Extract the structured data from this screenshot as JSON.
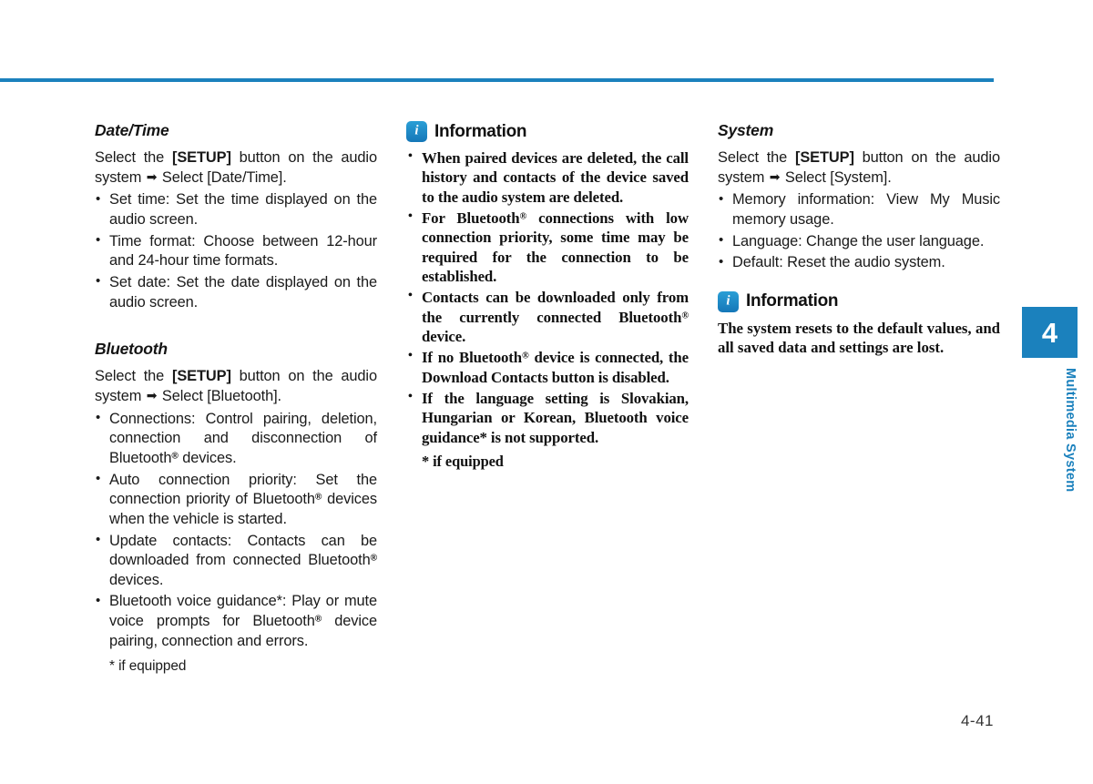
{
  "page": {
    "number": "4-41",
    "chapter_number": "4",
    "chapter_label": "Multimedia System",
    "accent_color": "#1b81bd",
    "arrow_glyph": "➡"
  },
  "left_column": {
    "sections": [
      {
        "heading": "Date/Time",
        "intro_prefix": "Select the ",
        "intro_button": "[SETUP]",
        "intro_middle": " button on the audio system ",
        "intro_suffix": " Select [Date/Time].",
        "bullets": [
          "Set time: Set the time displayed on the audio screen.",
          "Time format: Choose between 12-hour and 24-hour time formats.",
          "Set date: Set the date displayed on the audio screen."
        ]
      },
      {
        "heading": "Bluetooth",
        "intro_prefix": "Select the ",
        "intro_button": "[SETUP]",
        "intro_middle": " button on the audio system ",
        "intro_suffix": " Select [Bluetooth].",
        "bullets_rich": [
          [
            {
              "t": "Connections: Control pairing, deletion, connection and disconnection of Bluetooth"
            },
            {
              "reg": "®"
            },
            {
              "t": " devices."
            }
          ],
          [
            {
              "t": "Auto connection priority: Set the connection priority of Bluetooth"
            },
            {
              "reg": "®"
            },
            {
              "t": " devices when the vehicle is started."
            }
          ],
          [
            {
              "t": "Update contacts: Contacts can be downloaded from connected Bluetooth"
            },
            {
              "reg": "®"
            },
            {
              "t": " devices."
            }
          ],
          [
            {
              "t": "Bluetooth voice guidance*: Play or mute voice prompts for Bluetooth"
            },
            {
              "reg": "®"
            },
            {
              "t": " device pairing, connection and errors."
            }
          ]
        ],
        "footnote": "* if equipped"
      }
    ]
  },
  "middle_column": {
    "info_box": {
      "icon": "info-icon",
      "title": "Information",
      "bullets_rich": [
        [
          {
            "t": "When paired devices are deleted, the call history and contacts of the device saved to the audio system are deleted."
          }
        ],
        [
          {
            "t": "For Bluetooth"
          },
          {
            "reg": "®"
          },
          {
            "t": " connections with low connection priority, some time may be required for the connection to be established."
          }
        ],
        [
          {
            "t": "Contacts can be downloaded only from the currently connected Bluetooth"
          },
          {
            "reg": "®"
          },
          {
            "t": " device."
          }
        ],
        [
          {
            "t": "If no Bluetooth"
          },
          {
            "reg": "®"
          },
          {
            "t": " device is connected, the Download Contacts button is disabled."
          }
        ],
        [
          {
            "t": "If the language setting is Slovakian, Hungarian or Korean, Bluetooth voice guidance* is not supported."
          }
        ]
      ],
      "footnote": "* if equipped"
    }
  },
  "right_column": {
    "sections": [
      {
        "heading": "System",
        "intro_prefix": "Select the ",
        "intro_button": "[SETUP]",
        "intro_middle": " button on the audio system ",
        "intro_suffix": " Select [System].",
        "bullets": [
          "Memory information: View My Music memory usage.",
          "Language: Change the user language.",
          "Default: Reset the audio system."
        ]
      }
    ],
    "info_box": {
      "icon": "info-icon",
      "title": "Information",
      "paragraph": "The system resets to the default values, and all saved data and settings are lost."
    }
  }
}
